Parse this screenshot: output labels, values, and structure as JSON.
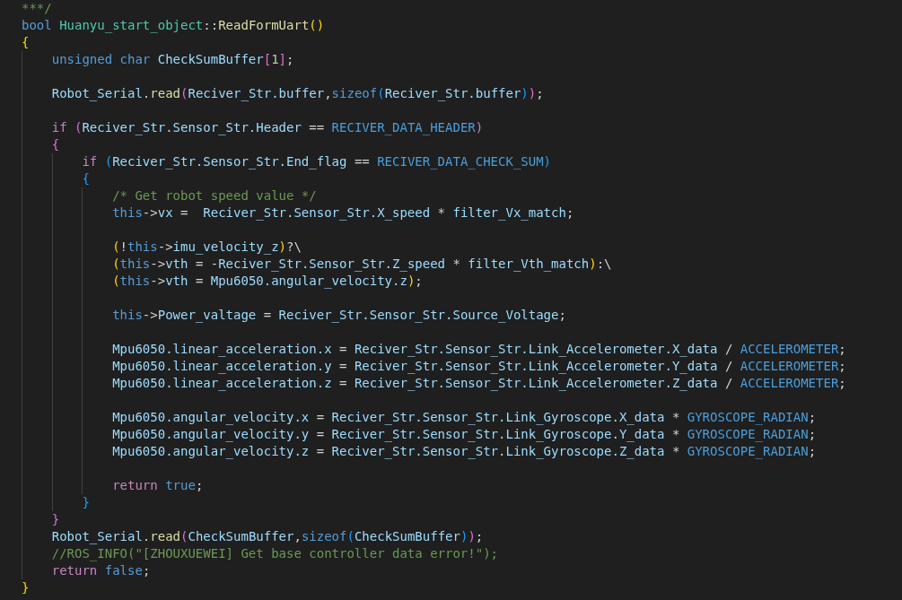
{
  "editor": {
    "lines": [
      {
        "kind": "code",
        "tokens": [
          {
            "text": "***/",
            "kind": "comment"
          }
        ]
      },
      {
        "kind": "code",
        "tokens": [
          {
            "text": "bool ",
            "kind": "keyword"
          },
          {
            "text": "Huanyu_start_object",
            "kind": "type"
          },
          {
            "text": "::",
            "kind": "plain"
          },
          {
            "text": "ReadFormUart",
            "kind": "func"
          },
          {
            "text": "()",
            "kind": "bracket1"
          }
        ]
      },
      {
        "kind": "code",
        "tokens": [
          {
            "text": "{",
            "kind": "bracket1"
          }
        ]
      },
      {
        "kind": "code",
        "tokens": [
          {
            "text": "    unsigned char ",
            "kind": "keyword"
          },
          {
            "text": "CheckSumBuffer",
            "kind": "var"
          },
          {
            "text": "[",
            "kind": "bracket2"
          },
          {
            "text": "1",
            "kind": "number"
          },
          {
            "text": "]",
            "kind": "bracket2"
          },
          {
            "text": ";",
            "kind": "plain"
          }
        ]
      },
      {
        "kind": "blank"
      },
      {
        "kind": "code",
        "tokens": [
          {
            "text": "    Robot_Serial",
            "kind": "var"
          },
          {
            "text": ".",
            "kind": "plain"
          },
          {
            "text": "read",
            "kind": "func"
          },
          {
            "text": "(",
            "kind": "bracket2"
          },
          {
            "text": "Reciver_Str.buffer",
            "kind": "var"
          },
          {
            "text": ",",
            "kind": "plain"
          },
          {
            "text": "sizeof",
            "kind": "keyword"
          },
          {
            "text": "(",
            "kind": "bracket3"
          },
          {
            "text": "Reciver_Str.buffer",
            "kind": "var"
          },
          {
            "text": ")",
            "kind": "bracket3"
          },
          {
            "text": ")",
            "kind": "bracket2"
          },
          {
            "text": ";",
            "kind": "plain"
          }
        ]
      },
      {
        "kind": "blank"
      },
      {
        "kind": "code",
        "tokens": [
          {
            "text": "    if ",
            "kind": "control"
          },
          {
            "text": "(",
            "kind": "bracket2"
          },
          {
            "text": "Reciver_Str.Sensor_Str.Header",
            "kind": "var"
          },
          {
            "text": " == ",
            "kind": "plain"
          },
          {
            "text": "RECIVER_DATA_HEADER",
            "kind": "macro"
          },
          {
            "text": ")",
            "kind": "bracket2"
          }
        ]
      },
      {
        "kind": "code",
        "tokens": [
          {
            "text": "    {",
            "kind": "bracket2"
          }
        ]
      },
      {
        "kind": "code",
        "tokens": [
          {
            "text": "        if ",
            "kind": "control"
          },
          {
            "text": "(",
            "kind": "bracket3"
          },
          {
            "text": "Reciver_Str.Sensor_Str.End_flag",
            "kind": "var"
          },
          {
            "text": " == ",
            "kind": "plain"
          },
          {
            "text": "RECIVER_DATA_CHECK_SUM",
            "kind": "macro"
          },
          {
            "text": ")",
            "kind": "bracket3"
          }
        ]
      },
      {
        "kind": "code",
        "tokens": [
          {
            "text": "        {",
            "kind": "bracket3"
          }
        ]
      },
      {
        "kind": "code",
        "tokens": [
          {
            "text": "            /* Get robot speed value */",
            "kind": "comment"
          }
        ]
      },
      {
        "kind": "code",
        "tokens": [
          {
            "text": "            this",
            "kind": "keyword"
          },
          {
            "text": "->",
            "kind": "plain"
          },
          {
            "text": "vx",
            "kind": "var"
          },
          {
            "text": " =  ",
            "kind": "plain"
          },
          {
            "text": "Reciver_Str.Sensor_Str.X_speed",
            "kind": "var"
          },
          {
            "text": " * ",
            "kind": "plain"
          },
          {
            "text": "filter_Vx_match",
            "kind": "var"
          },
          {
            "text": ";",
            "kind": "plain"
          }
        ]
      },
      {
        "kind": "blank"
      },
      {
        "kind": "code",
        "tokens": [
          {
            "text": "            (",
            "kind": "bracket1"
          },
          {
            "text": "!",
            "kind": "plain"
          },
          {
            "text": "this",
            "kind": "keyword"
          },
          {
            "text": "->",
            "kind": "plain"
          },
          {
            "text": "imu_velocity_z",
            "kind": "var"
          },
          {
            "text": ")",
            "kind": "bracket1"
          },
          {
            "text": "?\\",
            "kind": "plain"
          }
        ]
      },
      {
        "kind": "code",
        "tokens": [
          {
            "text": "            (",
            "kind": "bracket1"
          },
          {
            "text": "this",
            "kind": "keyword"
          },
          {
            "text": "->",
            "kind": "plain"
          },
          {
            "text": "vth",
            "kind": "var"
          },
          {
            "text": " = -",
            "kind": "plain"
          },
          {
            "text": "Reciver_Str.Sensor_Str.Z_speed",
            "kind": "var"
          },
          {
            "text": " * ",
            "kind": "plain"
          },
          {
            "text": "filter_Vth_match",
            "kind": "var"
          },
          {
            "text": ")",
            "kind": "bracket1"
          },
          {
            "text": ":\\",
            "kind": "plain"
          }
        ]
      },
      {
        "kind": "code",
        "tokens": [
          {
            "text": "            (",
            "kind": "bracket1"
          },
          {
            "text": "this",
            "kind": "keyword"
          },
          {
            "text": "->",
            "kind": "plain"
          },
          {
            "text": "vth",
            "kind": "var"
          },
          {
            "text": " = ",
            "kind": "plain"
          },
          {
            "text": "Mpu6050.angular_velocity.z",
            "kind": "var"
          },
          {
            "text": ")",
            "kind": "bracket1"
          },
          {
            "text": ";",
            "kind": "plain"
          }
        ]
      },
      {
        "kind": "blank"
      },
      {
        "kind": "code",
        "tokens": [
          {
            "text": "            this",
            "kind": "keyword"
          },
          {
            "text": "->",
            "kind": "plain"
          },
          {
            "text": "Power_valtage",
            "kind": "var"
          },
          {
            "text": " = ",
            "kind": "plain"
          },
          {
            "text": "Reciver_Str.Sensor_Str.Source_Voltage",
            "kind": "var"
          },
          {
            "text": ";",
            "kind": "plain"
          }
        ]
      },
      {
        "kind": "blank"
      },
      {
        "kind": "code",
        "tokens": [
          {
            "text": "            Mpu6050.linear_acceleration.x",
            "kind": "var"
          },
          {
            "text": " = ",
            "kind": "plain"
          },
          {
            "text": "Reciver_Str.Sensor_Str.Link_Accelerometer.X_data",
            "kind": "var"
          },
          {
            "text": " / ",
            "kind": "plain"
          },
          {
            "text": "ACCELEROMETER",
            "kind": "macro"
          },
          {
            "text": ";",
            "kind": "plain"
          }
        ]
      },
      {
        "kind": "code",
        "tokens": [
          {
            "text": "            Mpu6050.linear_acceleration.y",
            "kind": "var"
          },
          {
            "text": " = ",
            "kind": "plain"
          },
          {
            "text": "Reciver_Str.Sensor_Str.Link_Accelerometer.Y_data",
            "kind": "var"
          },
          {
            "text": " / ",
            "kind": "plain"
          },
          {
            "text": "ACCELEROMETER",
            "kind": "macro"
          },
          {
            "text": ";",
            "kind": "plain"
          }
        ]
      },
      {
        "kind": "code",
        "tokens": [
          {
            "text": "            Mpu6050.linear_acceleration.z",
            "kind": "var"
          },
          {
            "text": " = ",
            "kind": "plain"
          },
          {
            "text": "Reciver_Str.Sensor_Str.Link_Accelerometer.Z_data",
            "kind": "var"
          },
          {
            "text": " / ",
            "kind": "plain"
          },
          {
            "text": "ACCELEROMETER",
            "kind": "macro"
          },
          {
            "text": ";",
            "kind": "plain"
          }
        ]
      },
      {
        "kind": "blank"
      },
      {
        "kind": "code",
        "tokens": [
          {
            "text": "            Mpu6050.angular_velocity.x",
            "kind": "var"
          },
          {
            "text": " = ",
            "kind": "plain"
          },
          {
            "text": "Reciver_Str.Sensor_Str.Link_Gyroscope.X_data",
            "kind": "var"
          },
          {
            "text": " * ",
            "kind": "plain"
          },
          {
            "text": "GYROSCOPE_RADIAN",
            "kind": "macro"
          },
          {
            "text": ";",
            "kind": "plain"
          }
        ]
      },
      {
        "kind": "code",
        "tokens": [
          {
            "text": "            Mpu6050.angular_velocity.y",
            "kind": "var"
          },
          {
            "text": " = ",
            "kind": "plain"
          },
          {
            "text": "Reciver_Str.Sensor_Str.Link_Gyroscope.Y_data",
            "kind": "var"
          },
          {
            "text": " * ",
            "kind": "plain"
          },
          {
            "text": "GYROSCOPE_RADIAN",
            "kind": "macro"
          },
          {
            "text": ";",
            "kind": "plain"
          }
        ]
      },
      {
        "kind": "code",
        "tokens": [
          {
            "text": "            Mpu6050.angular_velocity.z",
            "kind": "var"
          },
          {
            "text": " = ",
            "kind": "plain"
          },
          {
            "text": "Reciver_Str.Sensor_Str.Link_Gyroscope.Z_data",
            "kind": "var"
          },
          {
            "text": " * ",
            "kind": "plain"
          },
          {
            "text": "GYROSCOPE_RADIAN",
            "kind": "macro"
          },
          {
            "text": ";",
            "kind": "plain"
          }
        ]
      },
      {
        "kind": "blank"
      },
      {
        "kind": "code",
        "tokens": [
          {
            "text": "            return ",
            "kind": "control"
          },
          {
            "text": "true",
            "kind": "keyword"
          },
          {
            "text": ";",
            "kind": "plain"
          }
        ]
      },
      {
        "kind": "code",
        "tokens": [
          {
            "text": "        }",
            "kind": "bracket3"
          }
        ]
      },
      {
        "kind": "code",
        "tokens": [
          {
            "text": "    }",
            "kind": "bracket2"
          }
        ]
      },
      {
        "kind": "code",
        "tokens": [
          {
            "text": "    Robot_Serial",
            "kind": "var"
          },
          {
            "text": ".",
            "kind": "plain"
          },
          {
            "text": "read",
            "kind": "func"
          },
          {
            "text": "(",
            "kind": "bracket2"
          },
          {
            "text": "CheckSumBuffer",
            "kind": "var"
          },
          {
            "text": ",",
            "kind": "plain"
          },
          {
            "text": "sizeof",
            "kind": "keyword"
          },
          {
            "text": "(",
            "kind": "bracket3"
          },
          {
            "text": "CheckSumBuffer",
            "kind": "var"
          },
          {
            "text": ")",
            "kind": "bracket3"
          },
          {
            "text": ")",
            "kind": "bracket2"
          },
          {
            "text": ";",
            "kind": "plain"
          }
        ]
      },
      {
        "kind": "code",
        "tokens": [
          {
            "text": "    //ROS_INFO(\"[ZHOUXUEWEI] Get base controller data error!\");",
            "kind": "comment"
          }
        ]
      },
      {
        "kind": "code",
        "tokens": [
          {
            "text": "    return ",
            "kind": "control"
          },
          {
            "text": "false",
            "kind": "keyword"
          },
          {
            "text": ";",
            "kind": "plain"
          }
        ]
      },
      {
        "kind": "code",
        "tokens": [
          {
            "text": "}",
            "kind": "bracket1"
          }
        ]
      }
    ]
  }
}
